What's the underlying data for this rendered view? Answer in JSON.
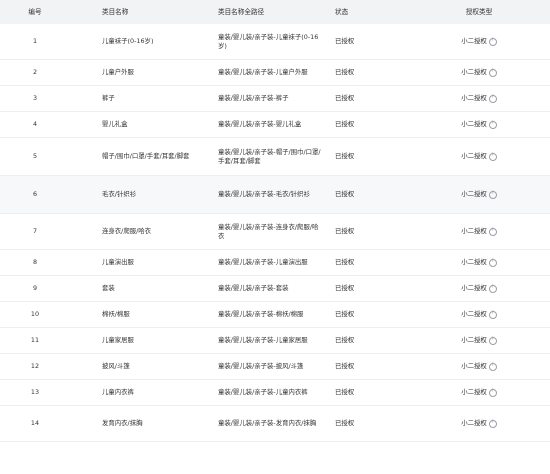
{
  "table": {
    "headers": {
      "id": "编号",
      "name": "类目名称",
      "path": "类目名称全路径",
      "status": "状态",
      "type": "授权类型"
    },
    "rows": [
      {
        "id": "1",
        "name": "儿童袜子(0-16岁)",
        "path": "童装/婴儿装/亲子装-儿童袜子(0-16岁)",
        "status": "已授权",
        "type": "小二授权"
      },
      {
        "id": "2",
        "name": "儿童户外服",
        "path": "童装/婴儿装/亲子装-儿童户外服",
        "status": "已授权",
        "type": "小二授权"
      },
      {
        "id": "3",
        "name": "裤子",
        "path": "童装/婴儿装/亲子装-裤子",
        "status": "已授权",
        "type": "小二授权"
      },
      {
        "id": "4",
        "name": "婴儿礼盒",
        "path": "童装/婴儿装/亲子装-婴儿礼盒",
        "status": "已授权",
        "type": "小二授权"
      },
      {
        "id": "5",
        "name": "帽子/围巾/口罩/手套/耳套/脚套",
        "path": "童装/婴儿装/亲子装-帽子/围巾/口罩/手套/耳套/脚套",
        "status": "已授权",
        "type": "小二授权"
      },
      {
        "id": "6",
        "name": "毛衣/针织衫",
        "path": "童装/婴儿装/亲子装-毛衣/针织衫",
        "status": "已授权",
        "type": "小二授权"
      },
      {
        "id": "7",
        "name": "连身衣/爬服/哈衣",
        "path": "童装/婴儿装/亲子装-连身衣/爬服/哈衣",
        "status": "已授权",
        "type": "小二授权"
      },
      {
        "id": "8",
        "name": "儿童演出服",
        "path": "童装/婴儿装/亲子装-儿童演出服",
        "status": "已授权",
        "type": "小二授权"
      },
      {
        "id": "9",
        "name": "套装",
        "path": "童装/婴儿装/亲子装-套装",
        "status": "已授权",
        "type": "小二授权"
      },
      {
        "id": "10",
        "name": "棉袄/棉服",
        "path": "童装/婴儿装/亲子装-棉袄/棉服",
        "status": "已授权",
        "type": "小二授权"
      },
      {
        "id": "11",
        "name": "儿童家居服",
        "path": "童装/婴儿装/亲子装-儿童家居服",
        "status": "已授权",
        "type": "小二授权"
      },
      {
        "id": "12",
        "name": "披风/斗篷",
        "path": "童装/婴儿装/亲子装-披风/斗篷",
        "status": "已授权",
        "type": "小二授权"
      },
      {
        "id": "13",
        "name": "儿童内衣裤",
        "path": "童装/婴儿装/亲子装-儿童内衣裤",
        "status": "已授权",
        "type": "小二授权"
      },
      {
        "id": "14",
        "name": "发育内衣/抹胸",
        "path": "童装/婴儿装/亲子装-发育内衣/抹胸",
        "status": "已授权",
        "type": "小二授权"
      }
    ]
  },
  "icons": {
    "help": "question-circle-icon"
  },
  "colors": {
    "header_bg": "#f2f3f5",
    "row_border": "#eceef1",
    "highlight_row_bg": "#f7f8fa",
    "text": "#333333",
    "icon": "#9aa0a8"
  }
}
